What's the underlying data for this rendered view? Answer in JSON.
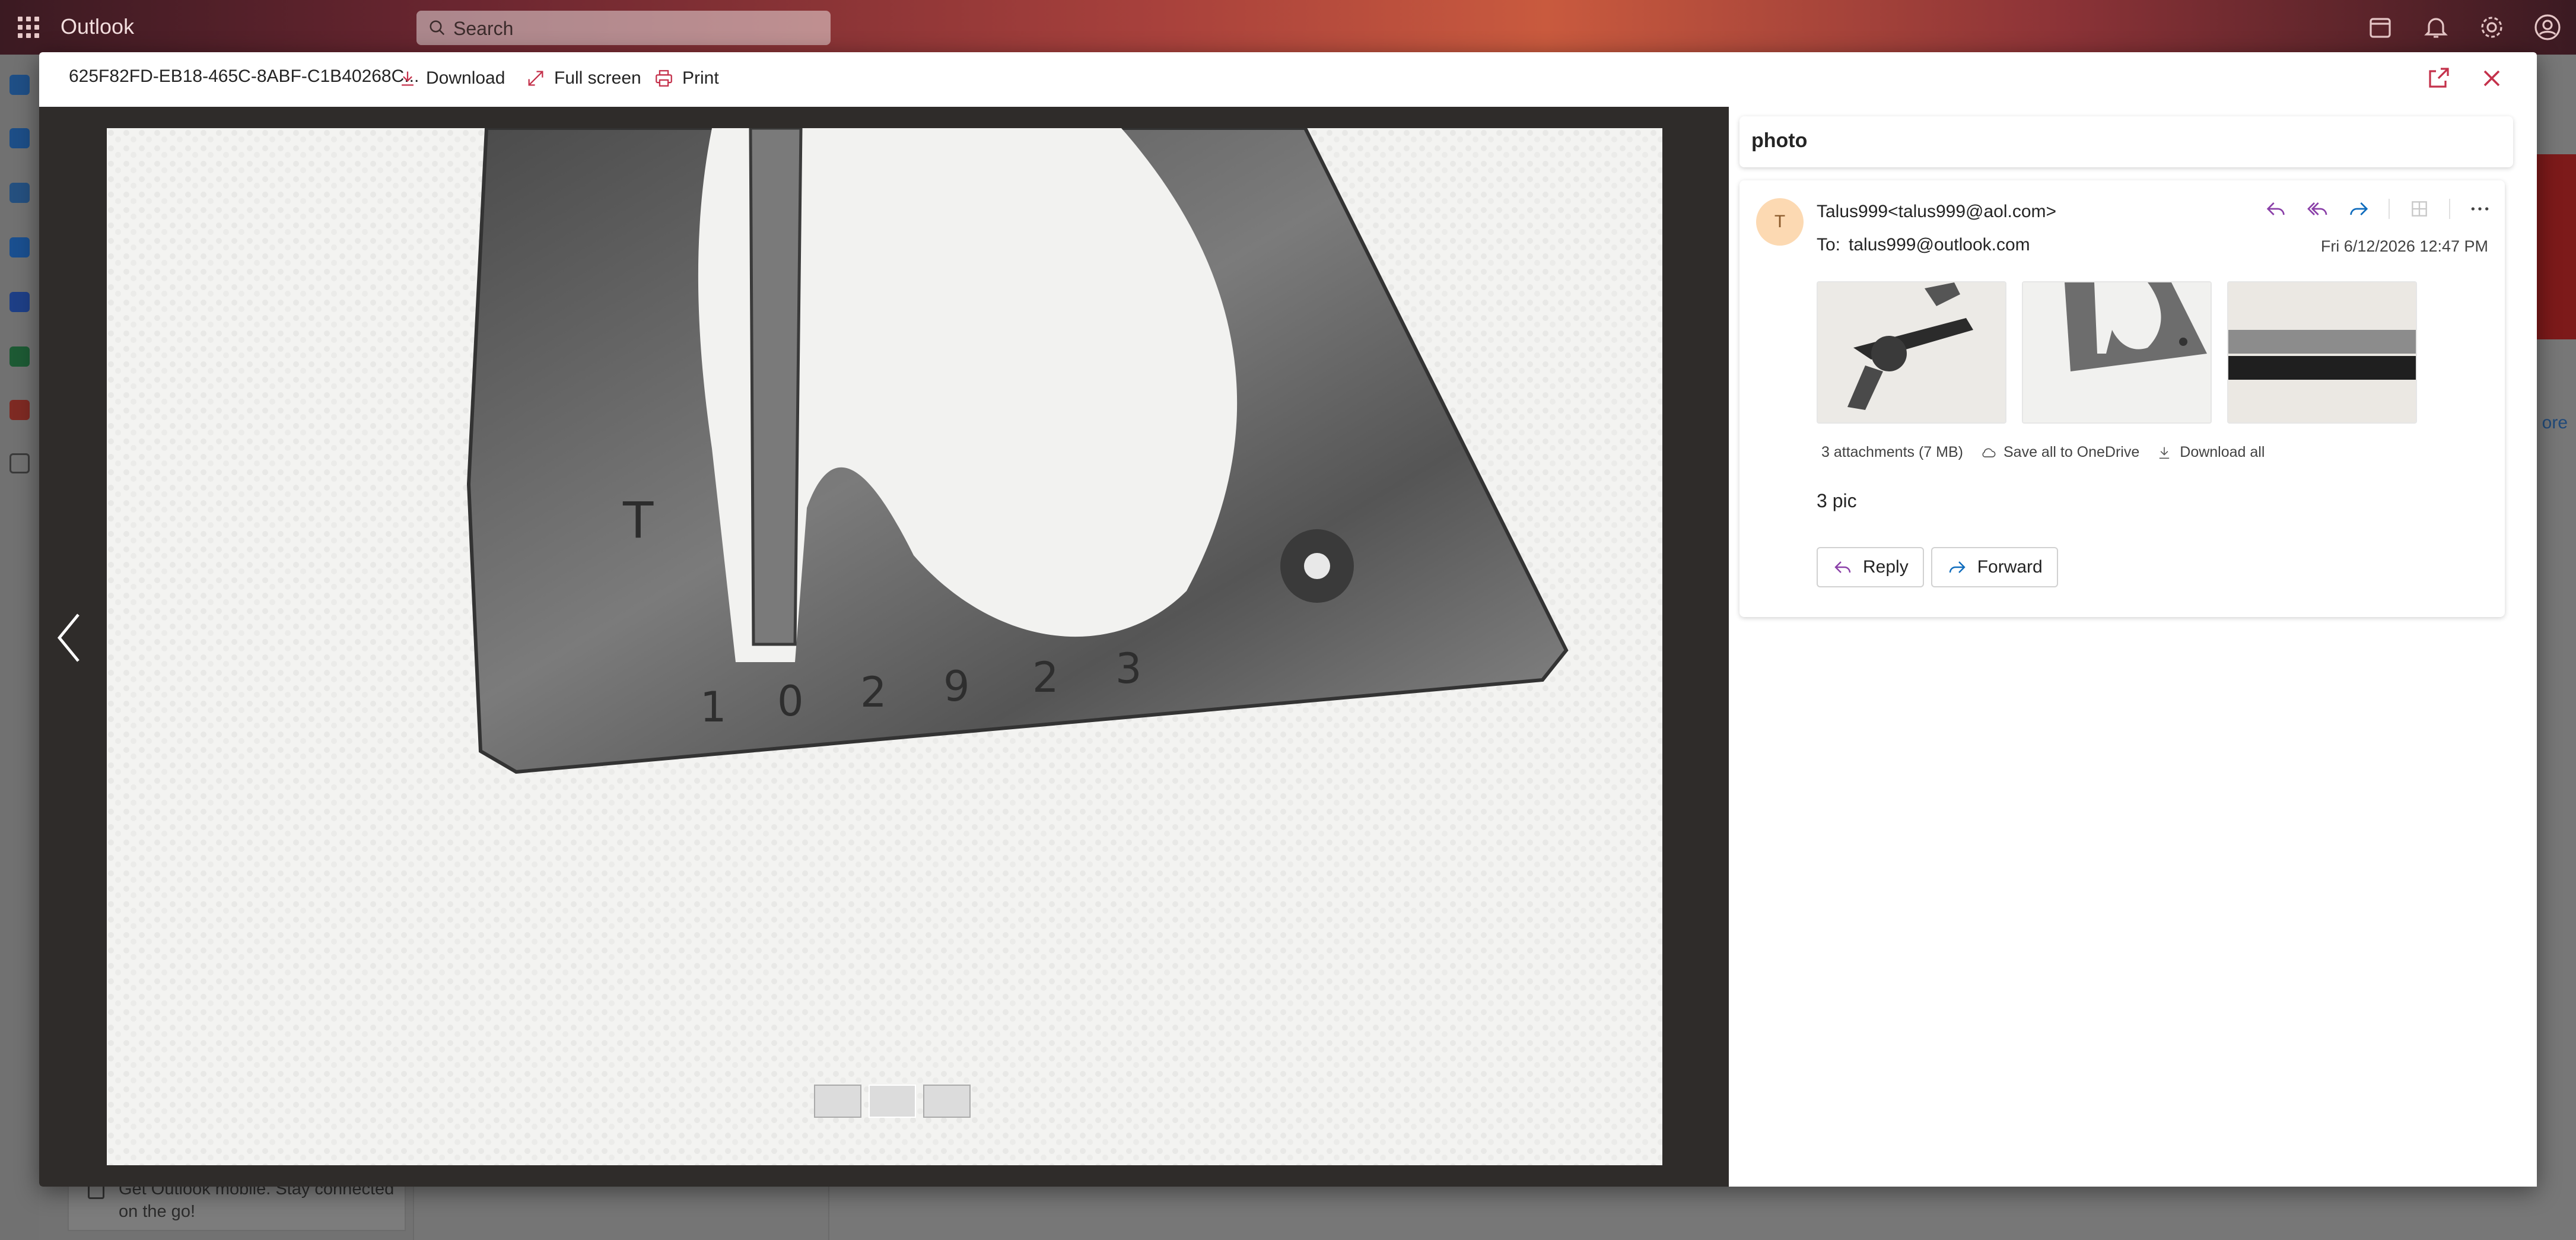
{
  "app": {
    "name": "Outlook",
    "search_placeholder": "Search"
  },
  "promo": {
    "text_line1": "Get Outlook mobile. Stay connected",
    "text_line2": "on the go!"
  },
  "background": {
    "ad_more": "ore"
  },
  "viewer": {
    "file_name": "625F82FD-EB18-465C-8ABF-C1B40268C...",
    "download_label": "Download",
    "fullscreen_label": "Full screen",
    "print_label": "Print"
  },
  "message": {
    "subject": "photo",
    "avatar_initial": "T",
    "sender": "Talus999<talus999@aol.com>",
    "to_label": "To:",
    "to_address": "talus999@outlook.com",
    "date": "Fri 6/12/2026 12:47 PM",
    "attachments_summary": "3 attachments (7 MB)",
    "save_onedrive_label": "Save all to OneDrive",
    "download_all_label": "Download all",
    "body": "3 pic",
    "reply_label": "Reply",
    "forward_label": "Forward"
  },
  "photo": {
    "stamped_digits": [
      "1",
      "0",
      "2",
      "9",
      "2",
      "3"
    ],
    "stamp_letter": "T"
  },
  "colors": {
    "accent": "#0f6cbd",
    "reply_purple": "#8a3fa8",
    "close_red": "#c4314b",
    "print_red": "#c4314b",
    "stage_bg": "#2f2c2a"
  }
}
